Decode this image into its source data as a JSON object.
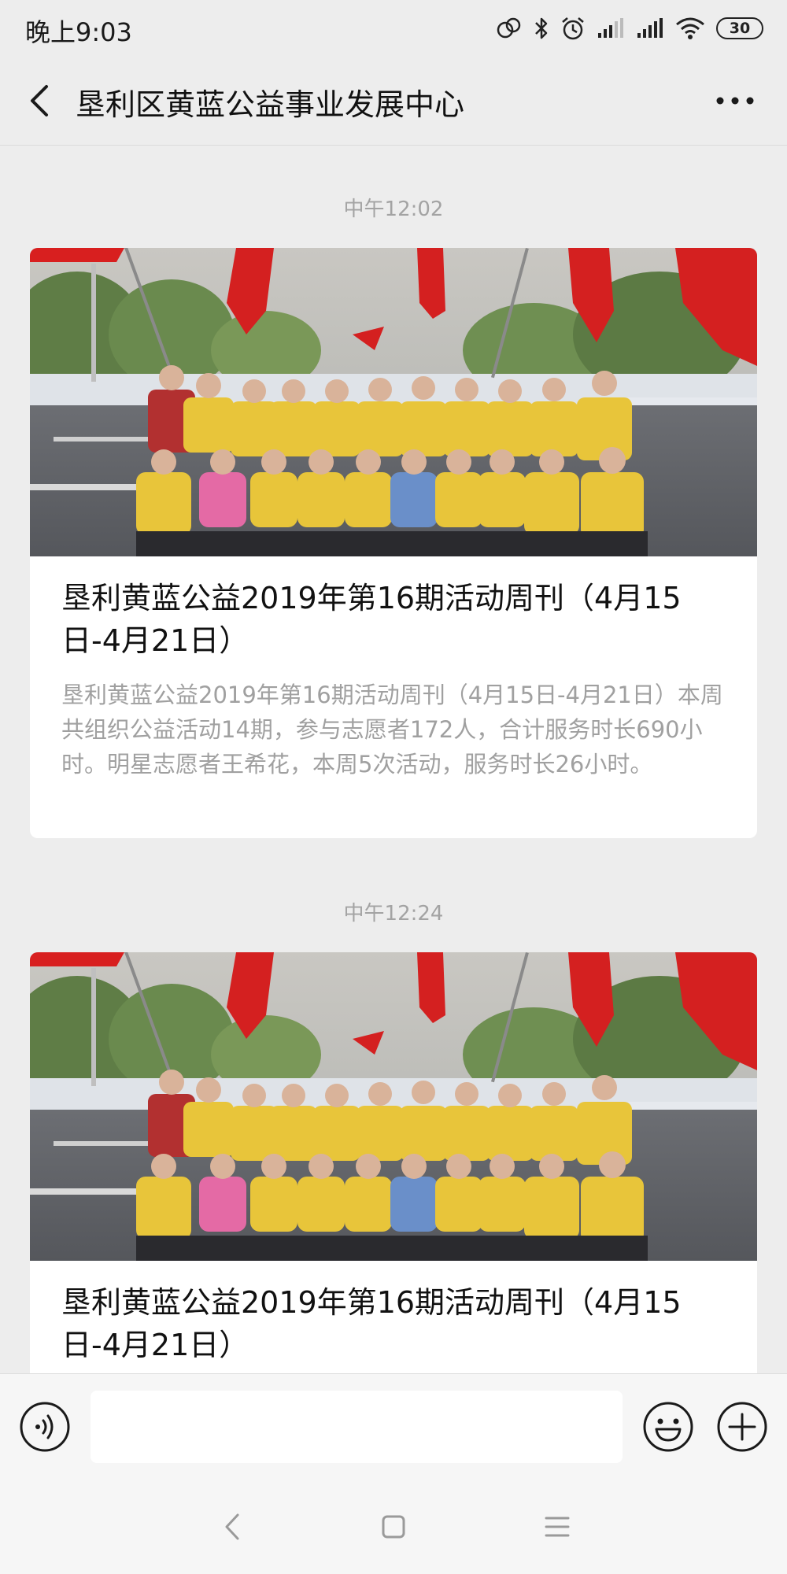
{
  "status_bar": {
    "time": "晚上9:03",
    "battery": "30",
    "icons": [
      "link-icon",
      "bluetooth-icon",
      "alarm-icon",
      "signal-icon",
      "signal-icon",
      "wifi-icon",
      "battery-icon"
    ]
  },
  "header": {
    "title": "垦利区黄蓝公益事业发展中心",
    "back_icon": "back-chevron-icon",
    "more_icon": "more-dots-icon"
  },
  "messages": [
    {
      "timestamp": "中午12:02",
      "article": {
        "title": "垦利黄蓝公益2019年第16期活动周刊（4月15日-4月21日）",
        "description": "垦利黄蓝公益2019年第16期活动周刊（4月15日-4月21日）本周共组织公益活动14期，参与志愿者172人，合计服务时长690小时。明星志愿者王希花，本周5次活动，服务时长26小时。",
        "image": "group-photo-volunteers"
      }
    },
    {
      "timestamp": "中午12:24",
      "article": {
        "title": "垦利黄蓝公益2019年第16期活动周刊（4月15日-4月21日）",
        "image": "group-photo-volunteers"
      }
    }
  ],
  "input_bar": {
    "placeholder": "",
    "voice_icon": "voice-icon",
    "emoji_icon": "emoji-icon",
    "add_icon": "add-icon"
  },
  "nav_bar": {
    "icons": [
      "nav-back-icon",
      "nav-home-icon",
      "nav-menu-icon"
    ]
  },
  "colors": {
    "background": "#ededed",
    "card": "#ffffff",
    "timestamp": "#a3a3a3",
    "description": "#a0a0a0",
    "flag_red": "#d81f1f",
    "vest_yellow": "#e8c53a"
  }
}
